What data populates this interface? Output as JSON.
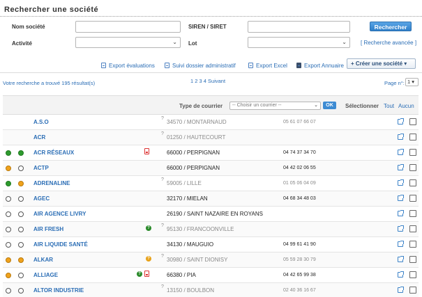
{
  "search": {
    "title": "Rechercher une société",
    "fields": {
      "nom_label": "Nom société",
      "siren_label": "SIREN / SIRET",
      "activite_label": "Activité",
      "lot_label": "Lot",
      "nom_value": "",
      "siren_value": ""
    },
    "button_label": "Rechercher",
    "advanced_link": "[ Recherche avancée ]"
  },
  "toolbar": {
    "export_evaluations": "Export évaluations",
    "suivi_dossier": "Suivi dossier administratif",
    "export_excel": "Export Excel",
    "export_annuaire": "Export Annuaire",
    "create_button": "+ Créer une société ▾"
  },
  "results": {
    "summary": "Votre recherche a trouvé 195 résultat(s)",
    "pagination": "1 2 3 4 Suivant",
    "page_label": "Page n°:",
    "page_value": "1 ▾"
  },
  "table_header": {
    "type_courrier_label": "Type de courrier",
    "courrier_placeholder": "-- Choisir un courrier --",
    "ok_label": "OK",
    "select_label": "Sélectionner",
    "all_label": "Tout",
    "none_label": "Aucun"
  },
  "status_colors": {
    "green": "#2e9a2e",
    "orange": "#f0a21c",
    "link": "#2a6db5"
  },
  "companies": [
    {
      "name": "A.S.O",
      "dot1": "none",
      "dot2": "none",
      "question": true,
      "status": "",
      "pdf": false,
      "city": "34570 / MONTARNAUD",
      "city_muted": true,
      "phone": "05 61 07 66 07",
      "phone_muted": true
    },
    {
      "name": "ACR",
      "dot1": "none",
      "dot2": "none",
      "question": true,
      "status": "",
      "pdf": false,
      "city": "01250 / HAUTECOURT",
      "city_muted": true,
      "phone": "",
      "phone_muted": true
    },
    {
      "name": "ACR RÉSEAUX",
      "dot1": "green",
      "dot2": "green",
      "question": false,
      "status": "",
      "pdf": true,
      "city": "66000 / PERPIGNAN",
      "city_muted": false,
      "phone": "04 74 37 34 70",
      "phone_muted": false
    },
    {
      "name": "ACTP",
      "dot1": "orange",
      "dot2": "empty",
      "question": false,
      "status": "",
      "pdf": false,
      "city": "66000 / PERPIGNAN",
      "city_muted": false,
      "phone": "04 42 02 06 55",
      "phone_muted": false
    },
    {
      "name": "ADRENALINE",
      "dot1": "green",
      "dot2": "orange",
      "question": true,
      "status": "",
      "pdf": false,
      "city": "59005 / LILLE",
      "city_muted": true,
      "phone": "01 05 06 04 09",
      "phone_muted": true
    },
    {
      "name": "AGEC",
      "dot1": "empty",
      "dot2": "empty",
      "question": false,
      "status": "",
      "pdf": false,
      "city": "32170 / MIELAN",
      "city_muted": false,
      "phone": "04 68 34 48 03",
      "phone_muted": false
    },
    {
      "name": "AIR AGENCE LIVRY",
      "dot1": "empty",
      "dot2": "empty",
      "question": false,
      "status": "",
      "pdf": false,
      "city": "26190 / SAINT NAZAIRE EN ROYANS",
      "city_muted": false,
      "phone": "",
      "phone_muted": false
    },
    {
      "name": "AIR FRESH",
      "dot1": "empty",
      "dot2": "empty",
      "question": true,
      "status": "green",
      "pdf": false,
      "city": "95130 / FRANCOONVILLE",
      "city_muted": true,
      "phone": "",
      "phone_muted": true
    },
    {
      "name": "AIR LIQUIDE SANTÉ",
      "dot1": "empty",
      "dot2": "empty",
      "question": false,
      "status": "",
      "pdf": false,
      "city": "34130 / MAUGUIO",
      "city_muted": false,
      "phone": "04 99 61 41 90",
      "phone_muted": false
    },
    {
      "name": "ALKAR",
      "dot1": "orange",
      "dot2": "orange",
      "question": true,
      "status": "orange",
      "pdf": false,
      "city": "30980 / SAINT DIONISY",
      "city_muted": true,
      "phone": "05 59 28 30 79",
      "phone_muted": true
    },
    {
      "name": "ALLIAGE",
      "dot1": "orange",
      "dot2": "empty",
      "question": false,
      "status": "green",
      "pdf": true,
      "city": "66380 / PIA",
      "city_muted": false,
      "phone": "04 42 65 99 38",
      "phone_muted": false
    },
    {
      "name": "ALTOR INDUSTRIE",
      "dot1": "empty",
      "dot2": "empty",
      "question": true,
      "status": "",
      "pdf": false,
      "city": "13150 / BOULBON",
      "city_muted": true,
      "phone": "02 40 36 16 67",
      "phone_muted": true
    }
  ]
}
